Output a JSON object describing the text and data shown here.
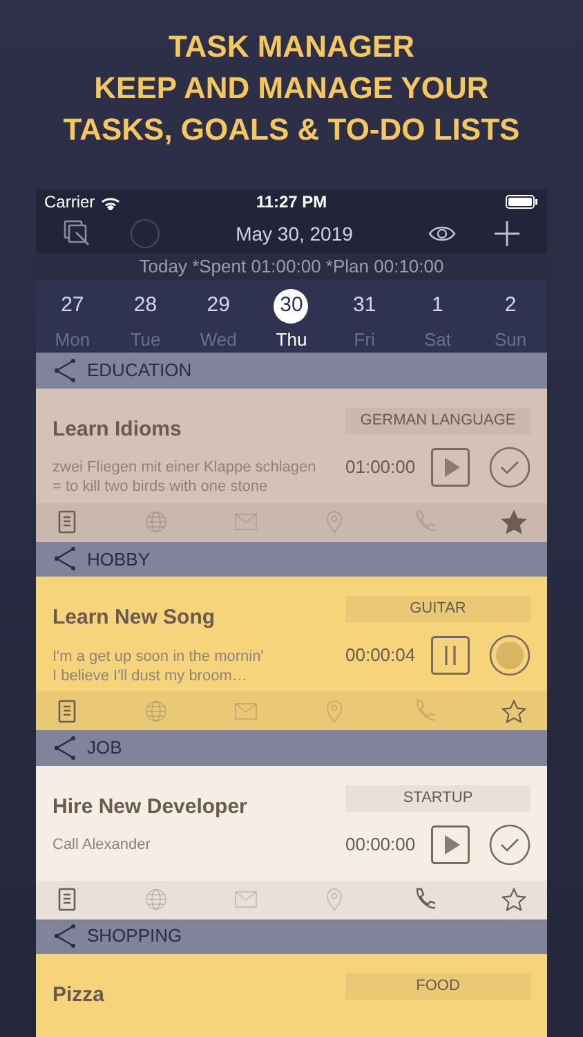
{
  "headline": [
    "TASK MANAGER",
    "KEEP AND MANAGE YOUR",
    "TASKS, GOALS & TO-DO LISTS"
  ],
  "status_bar": {
    "carrier": "Carrier",
    "time": "11:27 PM"
  },
  "toolbar": {
    "date": "May 30, 2019"
  },
  "summary": "Today *Spent 01:00:00 *Plan 00:10:00",
  "days": [
    {
      "number": "27",
      "weekday": "Mon",
      "selected": false
    },
    {
      "number": "28",
      "weekday": "Tue",
      "selected": false
    },
    {
      "number": "29",
      "weekday": "Wed",
      "selected": false
    },
    {
      "number": "30",
      "weekday": "Thu",
      "selected": true
    },
    {
      "number": "31",
      "weekday": "Fri",
      "selected": false
    },
    {
      "number": "1",
      "weekday": "Sat",
      "selected": false
    },
    {
      "number": "2",
      "weekday": "Sun",
      "selected": false
    }
  ],
  "groups": [
    {
      "name": "EDUCATION",
      "task": {
        "title": "Learn Idioms",
        "tag": "GERMAN LANGUAGE",
        "color": "#d5c1b7",
        "note": [
          "zwei Fliegen mit einer Klappe schlagen",
          "= to kill two birds with one stone"
        ],
        "timer": "01:00:00",
        "running": false,
        "starred": true,
        "attachments": [
          {
            "kind": "note",
            "active": true
          },
          {
            "kind": "web",
            "active": false
          },
          {
            "kind": "mail",
            "active": false
          },
          {
            "kind": "location",
            "active": false
          },
          {
            "kind": "phone",
            "active": false
          }
        ]
      }
    },
    {
      "name": "HOBBY",
      "task": {
        "title": "Learn New Song",
        "tag": "GUITAR",
        "color": "#f6d47c",
        "note": [
          "I'm a get up soon in the mornin'",
          "I believe I'll dust my broom…"
        ],
        "timer": "00:00:04",
        "running": true,
        "starred": false,
        "attachments": [
          {
            "kind": "note",
            "active": true
          },
          {
            "kind": "web",
            "active": false
          },
          {
            "kind": "mail",
            "active": false
          },
          {
            "kind": "location",
            "active": false
          },
          {
            "kind": "phone",
            "active": false
          }
        ]
      }
    },
    {
      "name": "JOB",
      "task": {
        "title": "Hire New Developer",
        "tag": "STARTUP",
        "color": "#f6eee5",
        "note": [
          "Call Alexander"
        ],
        "timer": "00:00:00",
        "running": false,
        "starred": false,
        "attachments": [
          {
            "kind": "note",
            "active": true
          },
          {
            "kind": "web",
            "active": false
          },
          {
            "kind": "mail",
            "active": false
          },
          {
            "kind": "location",
            "active": false
          },
          {
            "kind": "phone",
            "active": true
          }
        ]
      }
    },
    {
      "name": "SHOPPING",
      "task": {
        "title": "Pizza",
        "tag": "FOOD",
        "color": "#f6d47c"
      }
    }
  ]
}
